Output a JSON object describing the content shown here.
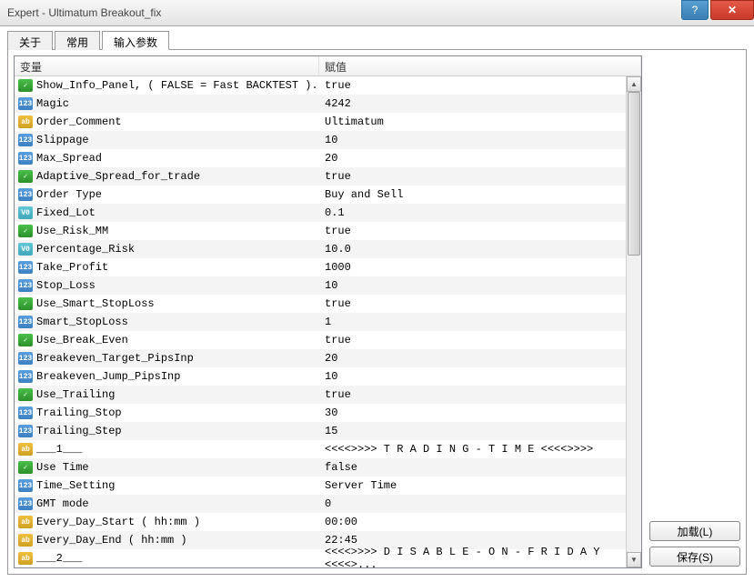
{
  "window": {
    "title": "Expert - Ultimatum Breakout_fix"
  },
  "tabs": {
    "t1": "关于",
    "t2": "常用",
    "t3": "输入参数"
  },
  "columns": {
    "var": "变量",
    "val": "赋值"
  },
  "buttons": {
    "load": "加载(L)",
    "save": "保存(S)"
  },
  "rows": [
    {
      "icon": "bool",
      "name": "Show_Info_Panel, ( FALSE = Fast BACKTEST ).",
      "value": "true"
    },
    {
      "icon": "int",
      "name": "Magic",
      "value": "4242"
    },
    {
      "icon": "str",
      "name": "Order_Comment",
      "value": "Ultimatum"
    },
    {
      "icon": "int",
      "name": "Slippage",
      "value": "10"
    },
    {
      "icon": "int",
      "name": "Max_Spread",
      "value": "20"
    },
    {
      "icon": "bool",
      "name": "Adaptive_Spread_for_trade",
      "value": "true"
    },
    {
      "icon": "int",
      "name": "Order Type",
      "value": "Buy and Sell"
    },
    {
      "icon": "dbl",
      "name": "Fixed_Lot",
      "value": "0.1"
    },
    {
      "icon": "bool",
      "name": "Use_Risk_MM",
      "value": "true"
    },
    {
      "icon": "dbl",
      "name": "Percentage_Risk",
      "value": "10.0"
    },
    {
      "icon": "int",
      "name": "Take_Profit",
      "value": "1000"
    },
    {
      "icon": "int",
      "name": "Stop_Loss",
      "value": "10"
    },
    {
      "icon": "bool",
      "name": "Use_Smart_StopLoss",
      "value": "true"
    },
    {
      "icon": "int",
      "name": "Smart_StopLoss",
      "value": "1"
    },
    {
      "icon": "bool",
      "name": "Use_Break_Even",
      "value": "true"
    },
    {
      "icon": "int",
      "name": "Breakeven_Target_PipsInp",
      "value": "20"
    },
    {
      "icon": "int",
      "name": "Breakeven_Jump_PipsInp",
      "value": "10"
    },
    {
      "icon": "bool",
      "name": "Use_Trailing",
      "value": "true"
    },
    {
      "icon": "int",
      "name": "Trailing_Stop",
      "value": "30"
    },
    {
      "icon": "int",
      "name": "Trailing_Step",
      "value": "15"
    },
    {
      "icon": "str",
      "name": "___1___",
      "value": "<<<<>>>> T R A D I N G - T I M E <<<<>>>>"
    },
    {
      "icon": "bool",
      "name": "Use Time",
      "value": "false"
    },
    {
      "icon": "int",
      "name": "Time_Setting",
      "value": "Server Time"
    },
    {
      "icon": "int",
      "name": "GMT mode",
      "value": "0"
    },
    {
      "icon": "str",
      "name": "Every_Day_Start ( hh:mm )",
      "value": "00:00"
    },
    {
      "icon": "str",
      "name": "Every_Day_End ( hh:mm )",
      "value": "22:45"
    },
    {
      "icon": "str",
      "name": "___2___",
      "value": "<<<<>>>> D I S A B L E - O N - F R I D A Y <<<<>..."
    }
  ],
  "iconText": {
    "bool": "✓",
    "int": "123",
    "str": "ab",
    "dbl": "V0"
  }
}
